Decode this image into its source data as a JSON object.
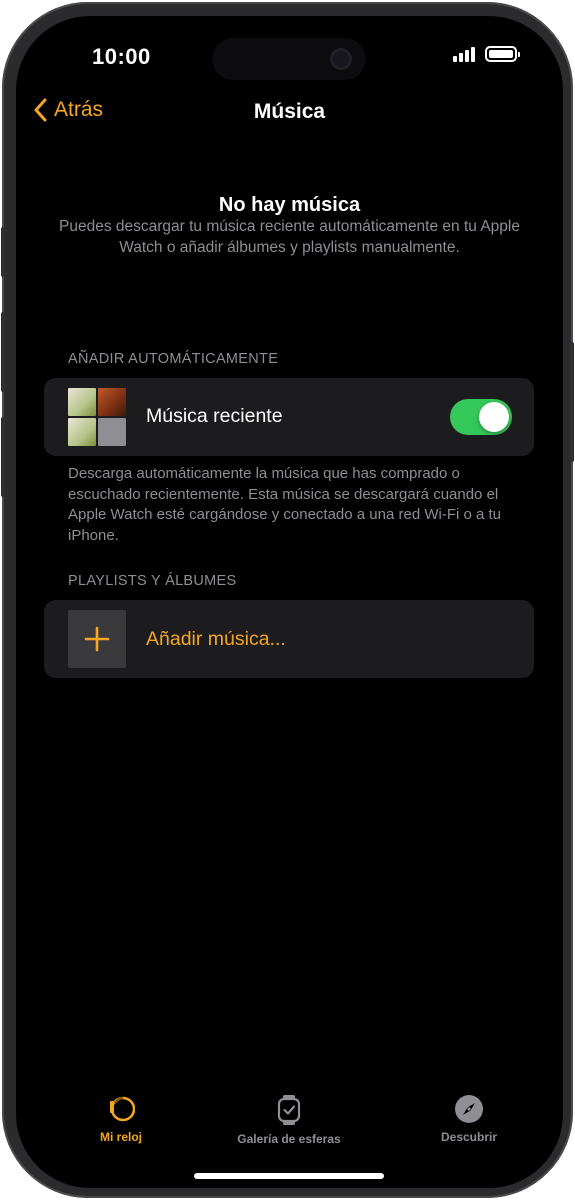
{
  "status_bar": {
    "time": "10:00"
  },
  "nav": {
    "back_label": "Atrás",
    "title": "Música"
  },
  "empty_state": {
    "title": "No hay música",
    "description": "Puedes descargar tu música reciente automáticamente en tu Apple Watch o añadir álbumes y playlists manualmente."
  },
  "auto_section": {
    "header": "AÑADIR AUTOMÁTICAMENTE",
    "row_label": "Música reciente",
    "toggle_on": true,
    "footer": "Descarga automáticamente la música que has comprado o escuchado recientemente. Esta música se descargará cuando el Apple Watch esté cargándose y conectado a una red Wi-Fi o a tu iPhone."
  },
  "playlists_section": {
    "header": "PLAYLISTS Y ÁLBUMES",
    "add_label": "Añadir música..."
  },
  "tab_bar": {
    "tabs": [
      {
        "label": "Mi reloj",
        "icon": "watch-icon",
        "active": true
      },
      {
        "label": "Galería de esferas",
        "icon": "watch-face-icon",
        "active": false
      },
      {
        "label": "Descubrir",
        "icon": "compass-icon",
        "active": false
      }
    ]
  },
  "colors": {
    "accent": "#f5a623",
    "toggle_on": "#34c759",
    "background": "#000000",
    "card": "#1c1c1e",
    "secondary_text": "#8e8e93",
    "inactive_tab": "#8e8e93"
  }
}
